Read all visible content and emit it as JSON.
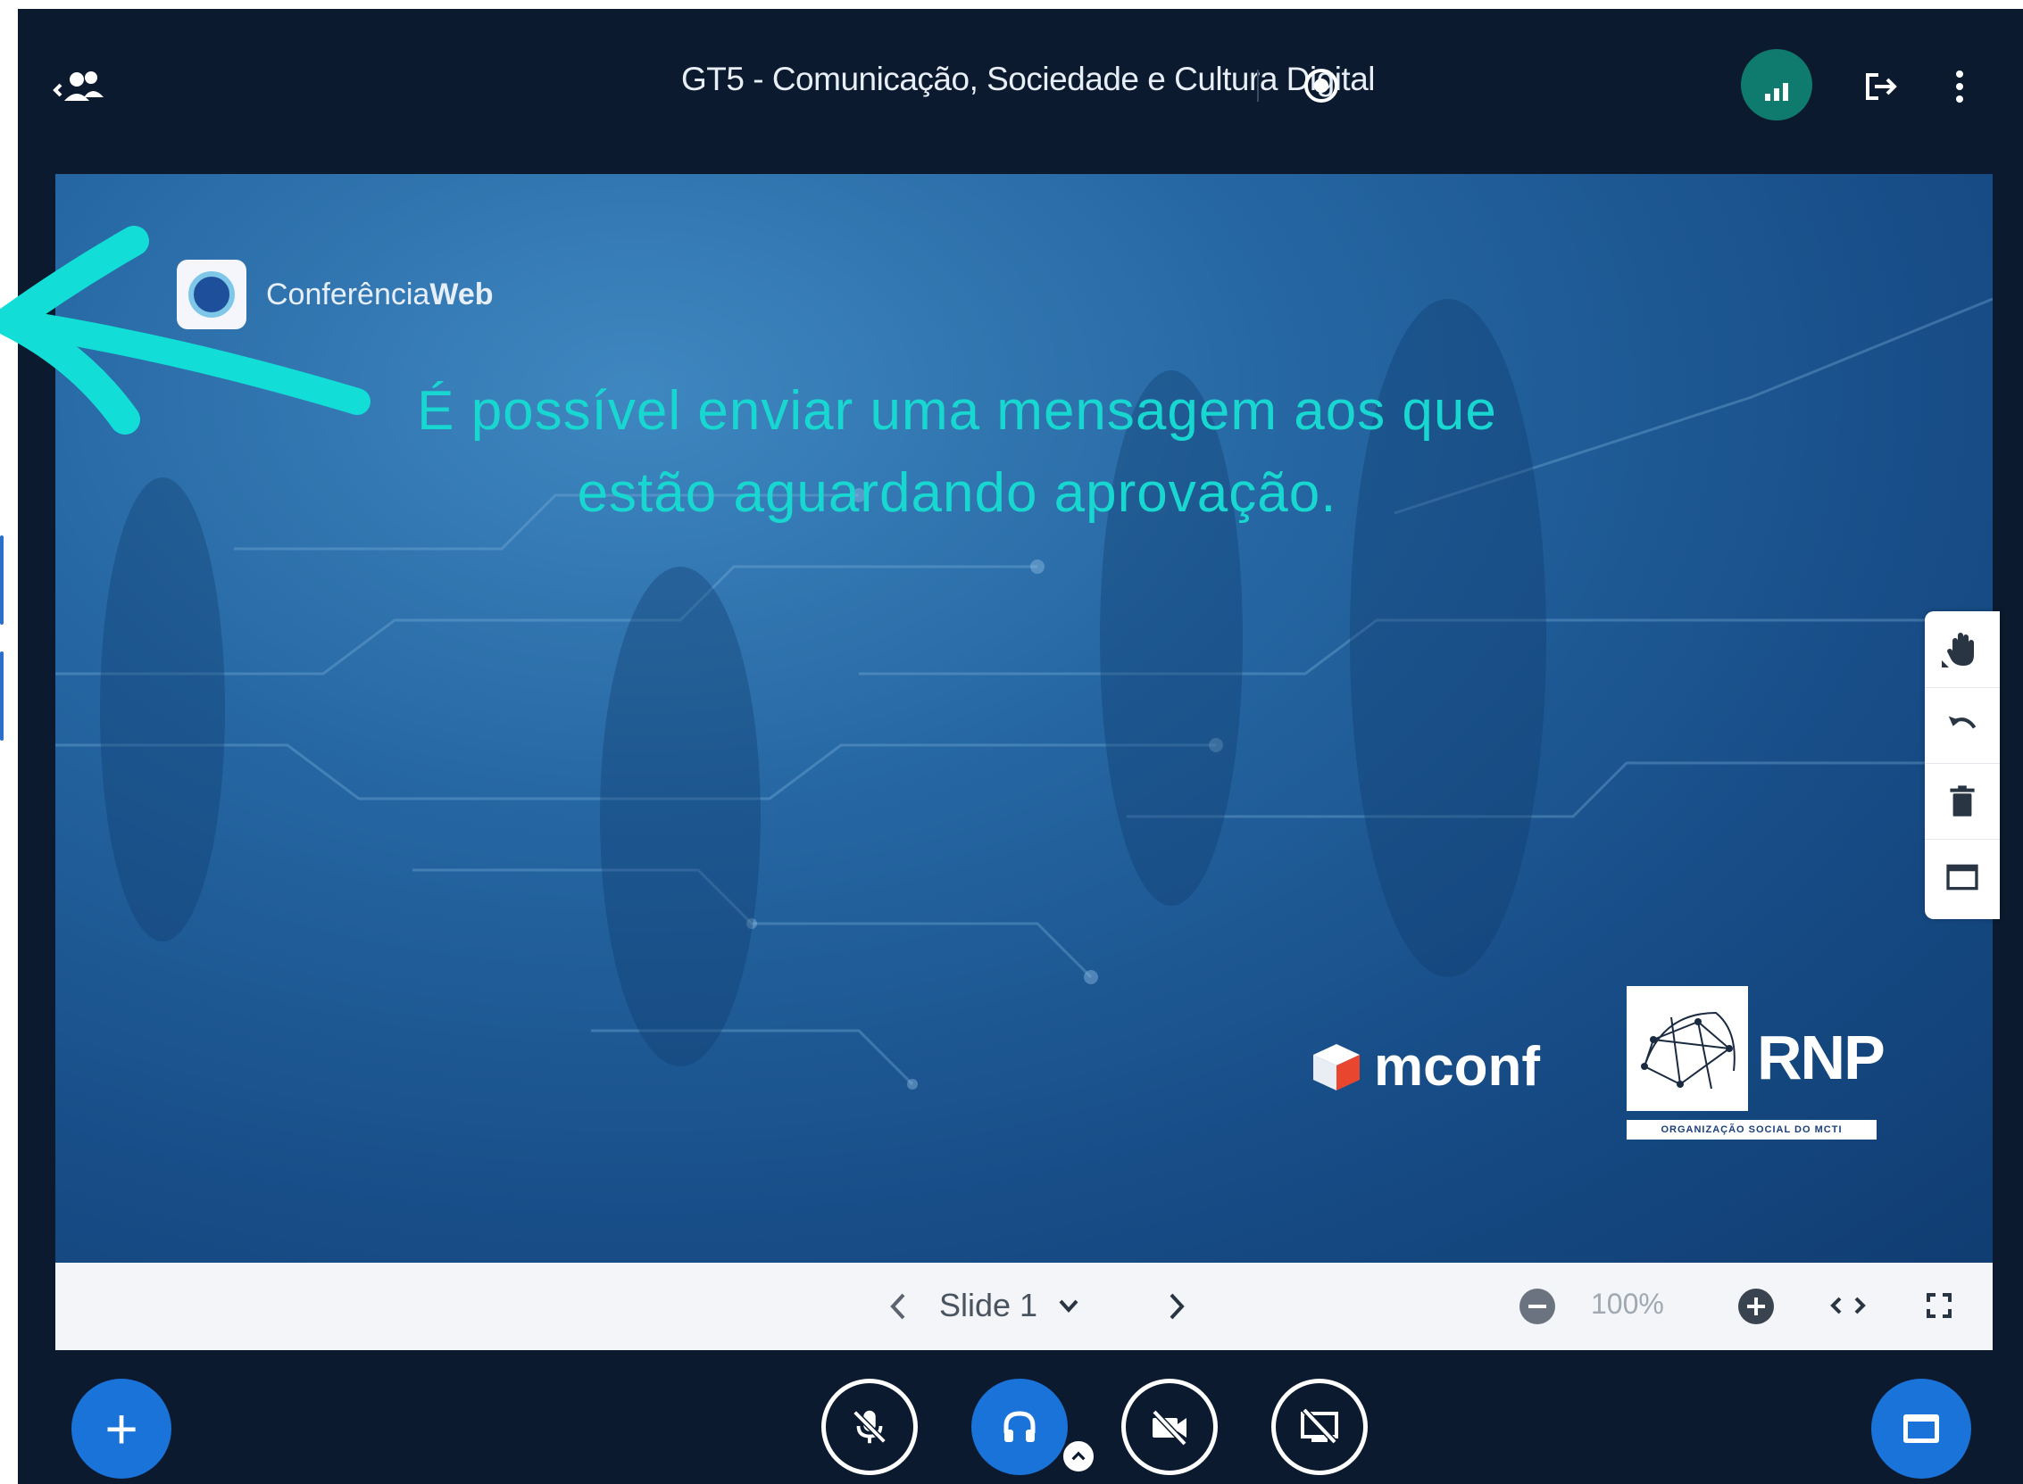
{
  "header": {
    "title": "GT5 - Comunicação, Sociedade e Cultura Digital",
    "icons": {
      "users_toggle": "users-icon",
      "record": "record-icon",
      "connection": "signal-bars-icon",
      "leave": "logout-icon",
      "more": "more-vertical-icon"
    }
  },
  "slide": {
    "logo_prefix": "Conferência",
    "logo_suffix": "Web",
    "message_line1": "É possível enviar uma mensagem aos que",
    "message_line2": "estão aguardando aprovação.",
    "mconf_label": "mconf",
    "rnp_label": "RNP",
    "rnp_subtitle": "ORGANIZAÇÃO SOCIAL DO MCTI"
  },
  "whiteboard_tools": [
    "hand-icon",
    "undo-icon",
    "trash-icon",
    "panel-icon"
  ],
  "slide_controls": {
    "slide_label": "Slide 1",
    "zoom": "100%"
  },
  "action_bar": {
    "actions_label": "+",
    "buttons": [
      "mic-muted-icon",
      "headphones-icon",
      "camera-off-icon",
      "screenshare-off-icon"
    ]
  },
  "colors": {
    "background": "#0b1a2e",
    "accent_blue": "#1a73d8",
    "connection_green": "#0f7b6e",
    "annotation_teal": "#18d6d0"
  }
}
